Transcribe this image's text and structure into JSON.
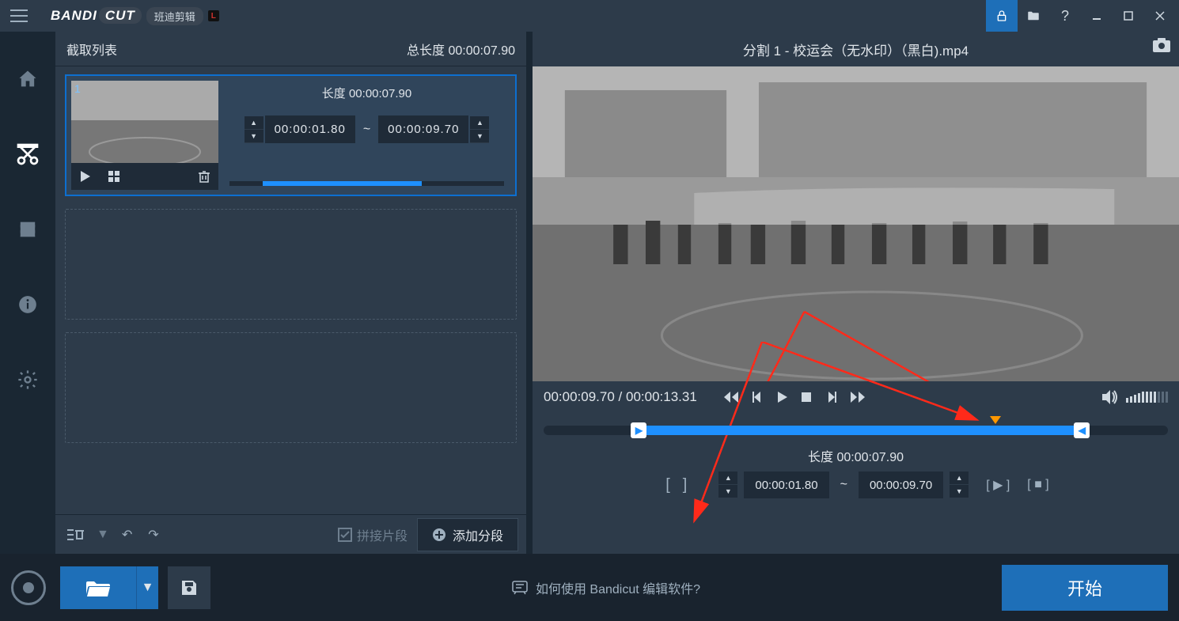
{
  "brand": {
    "name": "BANDI",
    "suffix": "CUT",
    "sub": "班迪剪辑"
  },
  "leftPanel": {
    "listTitle": "截取列表",
    "totalLenLabel": "总长度",
    "totalLen": "00:00:07.90",
    "clip": {
      "index": "1",
      "lenLabel": "长度",
      "lenValue": "00:00:07.90",
      "start": "00:00:01.80",
      "end": "00:00:09.70",
      "sep": "~"
    },
    "mergeLabel": "拼接片段",
    "addSegment": "添加分段"
  },
  "preview": {
    "title": "分割 1 - 校运会（无水印）（黑白).mp4",
    "current": "00:00:09.70",
    "total": "00:00:13.31",
    "sep": " / ",
    "lenLabel": "长度",
    "lenValue": "00:00:07.90",
    "start": "00:00:01.80",
    "end": "00:00:09.70",
    "tsep": "~"
  },
  "footer": {
    "helpText": "如何使用 Bandicut 编辑软件?",
    "startLabel": "开始"
  }
}
